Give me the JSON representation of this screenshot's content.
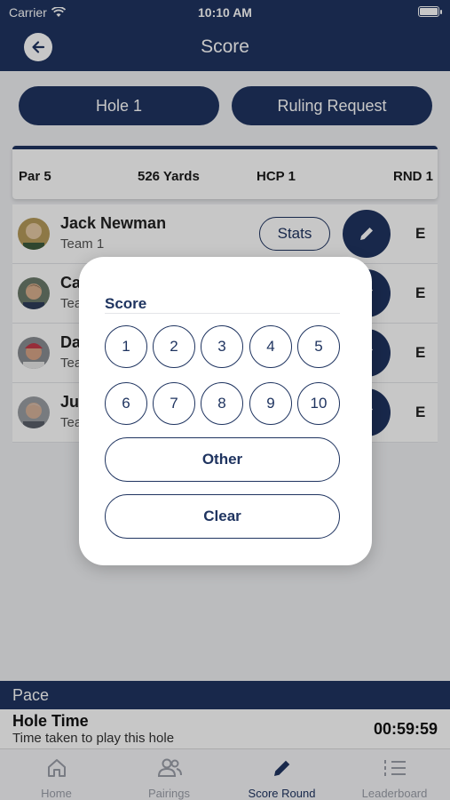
{
  "status_bar": {
    "carrier": "Carrier",
    "time": "10:10 AM"
  },
  "navbar": {
    "title": "Score"
  },
  "top_buttons": {
    "hole": "Hole 1",
    "ruling": "Ruling Request"
  },
  "hole_info": {
    "par": "Par 5",
    "yards": "526 Yards",
    "hcp": "HCP 1",
    "round": "RND 1"
  },
  "players": [
    {
      "name": "Jack Newman",
      "team": "Team 1",
      "score": "E",
      "stats_label": "Stats"
    },
    {
      "name": "Ca",
      "team": "Tea",
      "score": "E"
    },
    {
      "name": "Da",
      "team": "Tea",
      "score": "E"
    },
    {
      "name": "Ju",
      "team": "Tea",
      "score": "E"
    }
  ],
  "modal": {
    "title": "Score",
    "numbers": [
      "1",
      "2",
      "3",
      "4",
      "5",
      "6",
      "7",
      "8",
      "9",
      "10"
    ],
    "other_label": "Other",
    "clear_label": "Clear"
  },
  "pace": {
    "header": "Pace",
    "hole_time_title": "Hole Time",
    "hole_time_sub": "Time taken to play this hole",
    "hole_time_value": "00:59:59"
  },
  "tabs": [
    {
      "label": "Home",
      "icon": "home-icon"
    },
    {
      "label": "Pairings",
      "icon": "pairings-icon"
    },
    {
      "label": "Score Round",
      "icon": "pencil-icon"
    },
    {
      "label": "Leaderboard",
      "icon": "leaderboard-icon"
    }
  ],
  "colors": {
    "navy": "#1f3460",
    "background": "#f0f1f4",
    "tab_inactive": "#9a9ea8"
  }
}
